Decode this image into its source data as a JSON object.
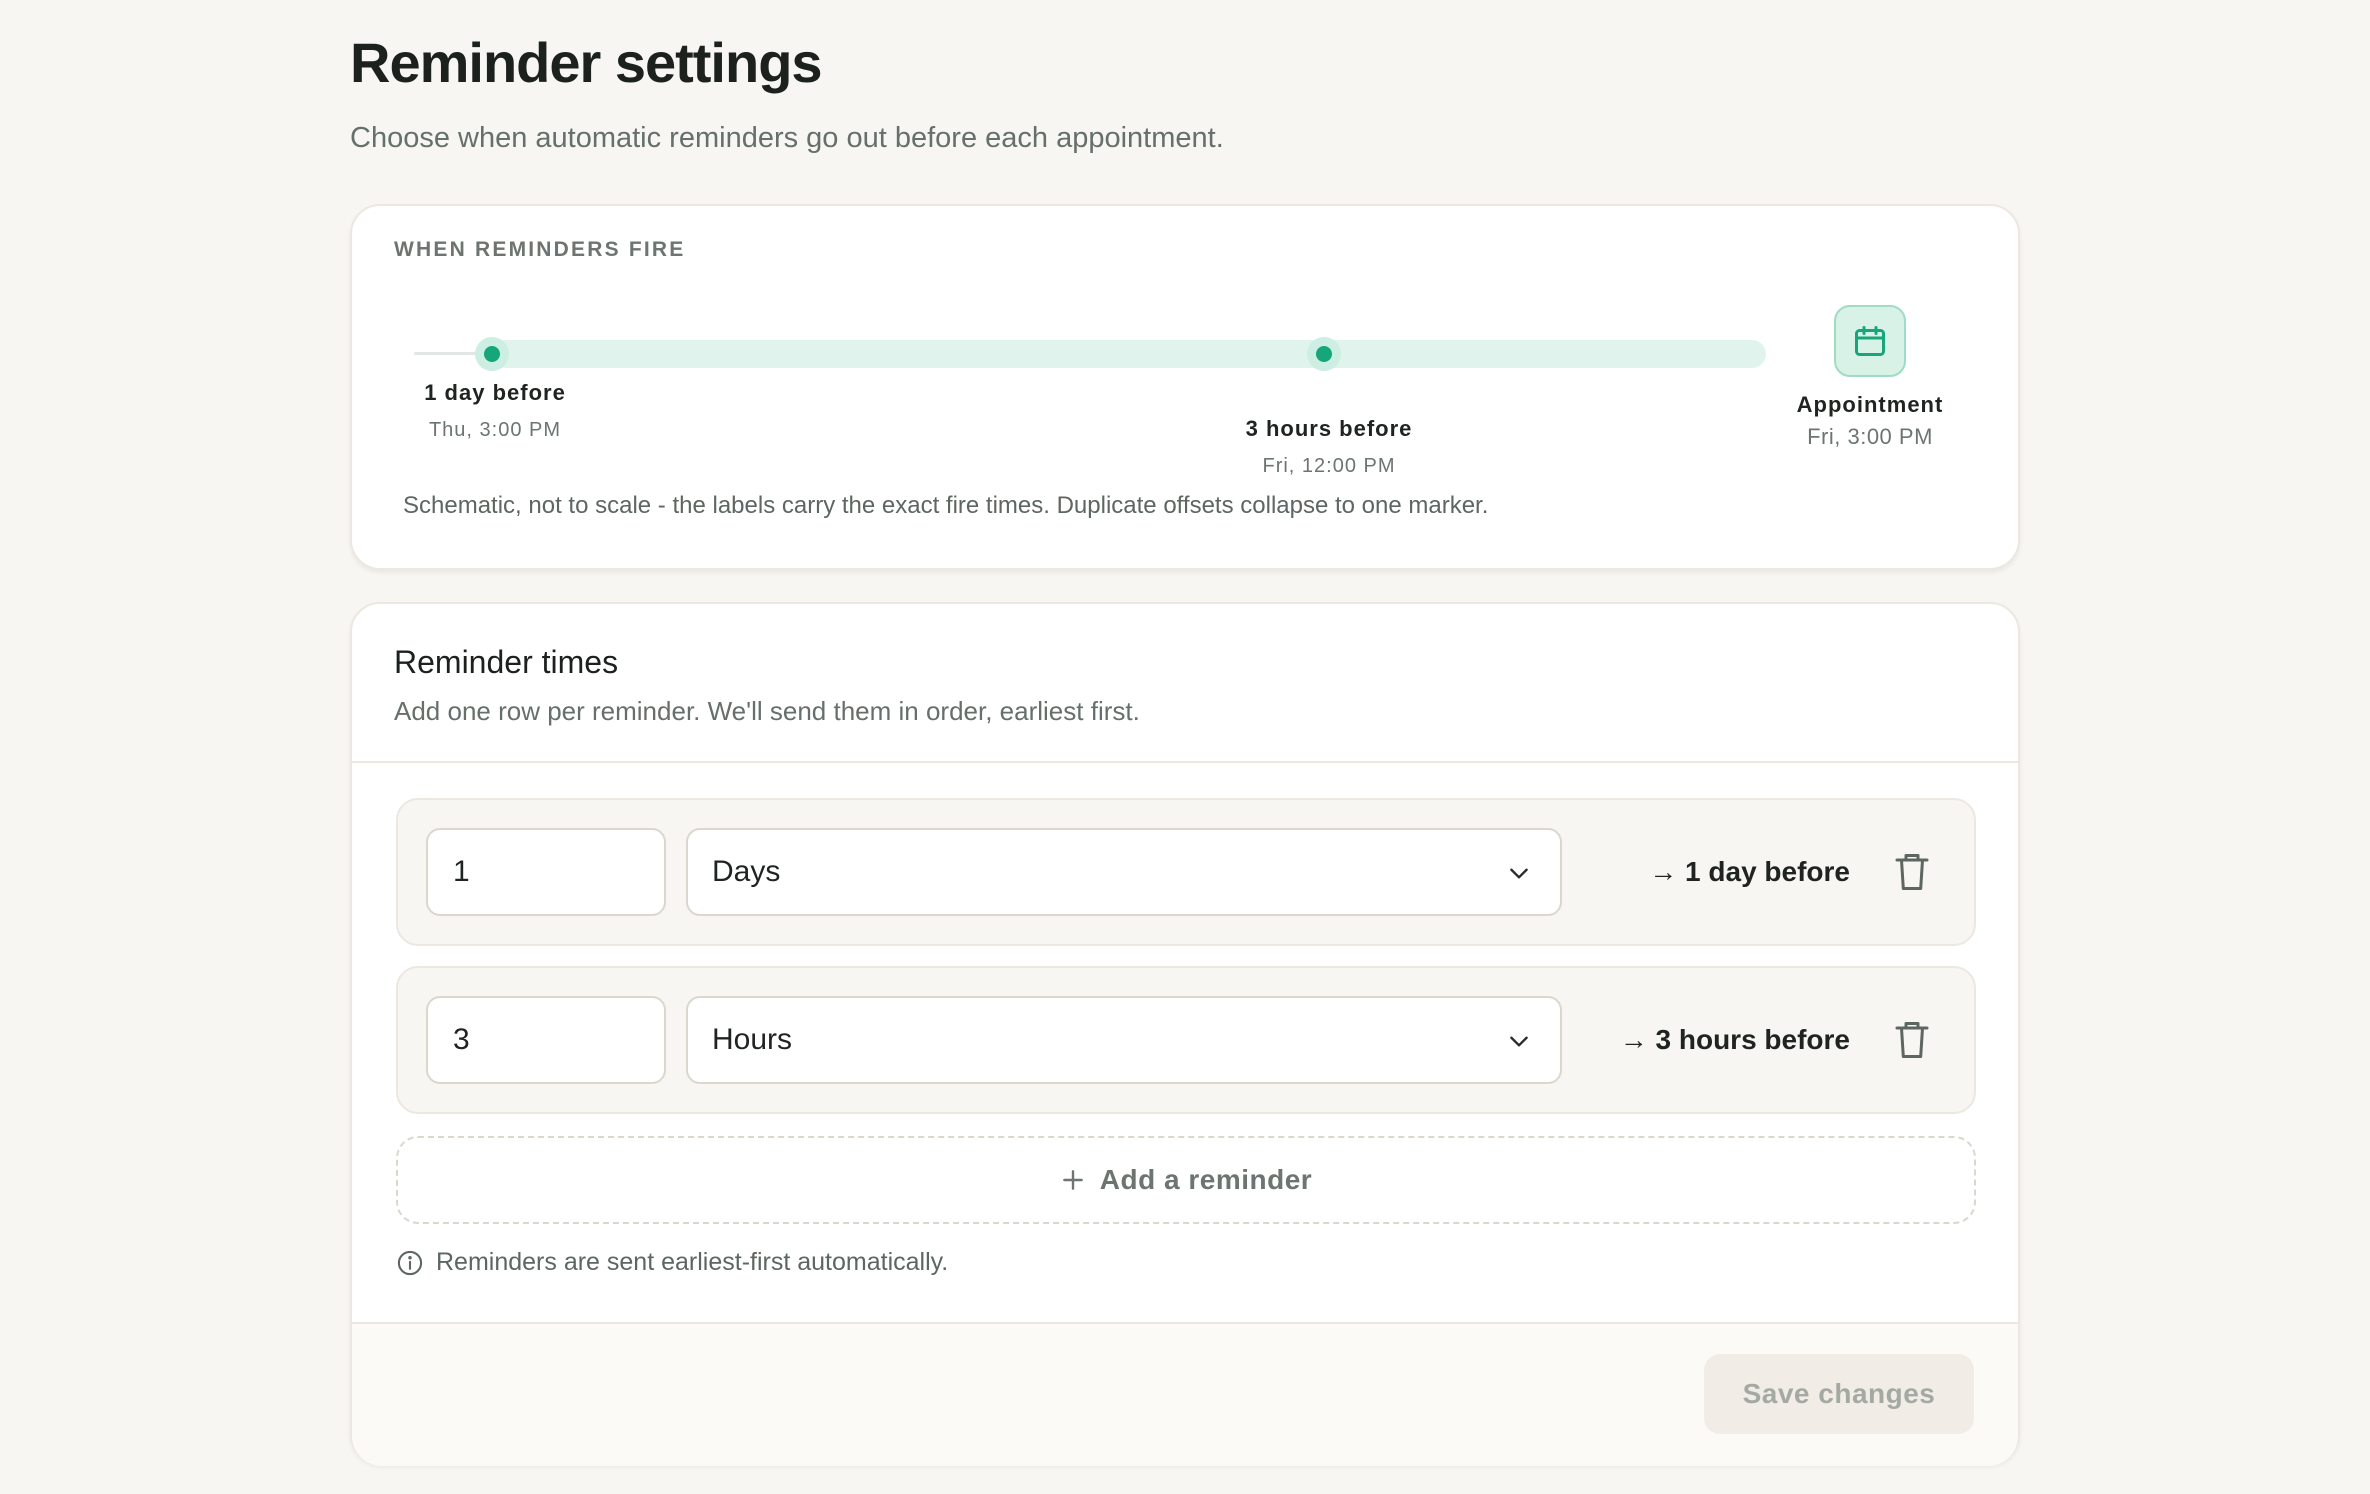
{
  "page": {
    "title": "Reminder settings",
    "subtitle": "Choose when automatic reminders go out before each appointment."
  },
  "timeline": {
    "heading": "WHEN REMINDERS FIRE",
    "markers": [
      {
        "label": "1 day before",
        "time": "Thu, 3:00 PM"
      },
      {
        "label": "3 hours before",
        "time": "Fri, 12:00 PM"
      }
    ],
    "appointment": {
      "label": "Appointment",
      "time": "Fri, 3:00 PM",
      "icon": "calendar-icon"
    },
    "note": "Schematic, not to scale - the labels carry the exact fire times. Duplicate offsets collapse to one marker."
  },
  "reminders": {
    "title": "Reminder times",
    "description": "Add one row per reminder. We'll send them in order, earliest first.",
    "rows": [
      {
        "amount": "1",
        "unit": "Days",
        "summary": "→ 1 day before"
      },
      {
        "amount": "3",
        "unit": "Hours",
        "summary": "→ 3 hours before"
      }
    ],
    "add_label": "Add a reminder",
    "info": "Reminders are sent earliest-first automatically.",
    "save_label": "Save changes"
  },
  "colors": {
    "accent": "#17a67a",
    "accent_soft": "#e0f3ec",
    "background": "#f8f6f2"
  }
}
